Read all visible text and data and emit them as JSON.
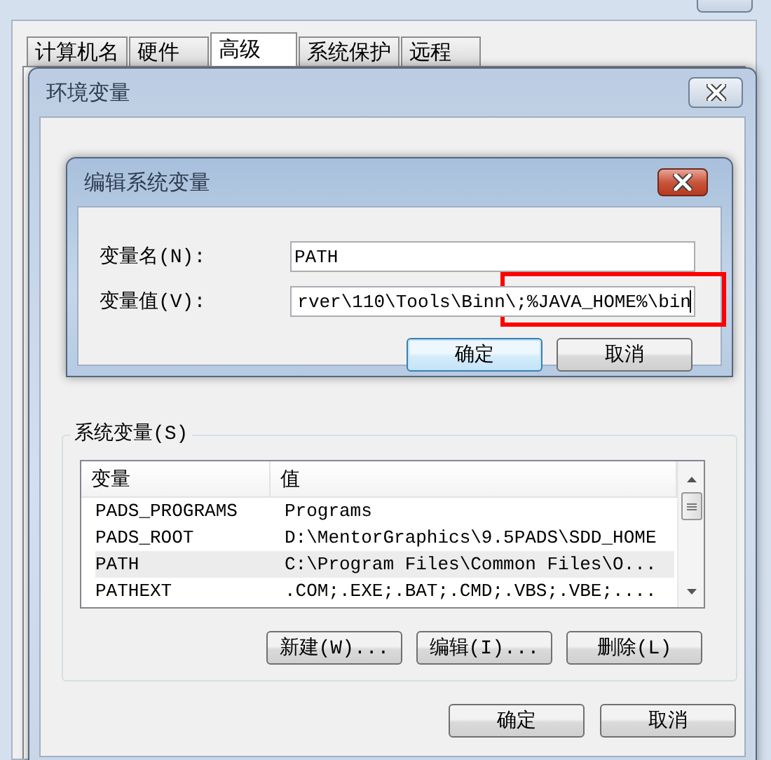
{
  "system_properties": {
    "tabs": [
      {
        "label": "计算机名",
        "selected": false
      },
      {
        "label": "硬件",
        "selected": false
      },
      {
        "label": "高级",
        "selected": true
      },
      {
        "label": "系统保护",
        "selected": false
      },
      {
        "label": "远程",
        "selected": false
      }
    ]
  },
  "environment_variables": {
    "title": "环境变量",
    "active": false,
    "system_group": {
      "title": "系统变量(S)",
      "columns": [
        "变量",
        "值"
      ],
      "rows": [
        {
          "name": "PADS_PROGRAMS",
          "value": "Programs",
          "selected": false
        },
        {
          "name": "PADS_ROOT",
          "value": "D:\\MentorGraphics\\9.5PADS\\SDD_HOME",
          "selected": false
        },
        {
          "name": "PATH",
          "value": "C:\\Program Files\\Common Files\\O...",
          "selected": true
        },
        {
          "name": "PATHEXT",
          "value": ".COM;.EXE;.BAT;.CMD;.VBS;.VBE;....",
          "selected": false
        }
      ],
      "buttons": [
        "新建(W)...",
        "编辑(I)...",
        "删除(L)"
      ]
    },
    "buttons": [
      "确定",
      "取消"
    ]
  },
  "edit_dialog": {
    "title": "编辑系统变量",
    "active": true,
    "fields": [
      {
        "label": "变量名(N):",
        "value": "PATH"
      },
      {
        "label": "变量值(V):",
        "value": "rver\\110\\Tools\\Binn\\;%JAVA_HOME%\\bin"
      }
    ],
    "buttons": [
      {
        "label": "确定",
        "focused": true
      },
      {
        "label": "取消",
        "focused": false
      }
    ],
    "highlight": true
  }
}
